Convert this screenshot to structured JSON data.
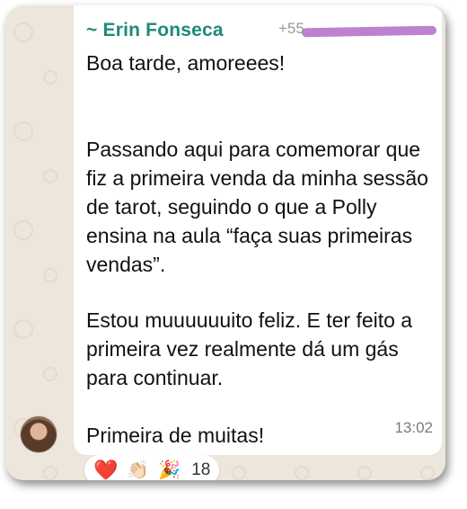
{
  "message": {
    "sender_name": "~ Erin Fonseca",
    "sender_phone": "+55",
    "paragraphs": [
      "Boa tarde, amoreees!",
      "Passando aqui para comemorar que fiz a primeira venda da minha sessão de tarot, seguindo o que a Polly ensina na aula “faça suas primeiras vendas”.",
      "Estou muuuuuuito feliz. E ter feito a primeira vez realmente dá um gás para continuar.",
      "Primeira de muitas!"
    ],
    "time": "13:02"
  },
  "reactions": {
    "emojis": [
      {
        "icon": "heart-icon",
        "glyph": "❤️"
      },
      {
        "icon": "clapping-hands-icon",
        "glyph": "👏🏻"
      },
      {
        "icon": "party-popper-icon",
        "glyph": "🎉"
      }
    ],
    "count": "18"
  },
  "colors": {
    "sender_name": "#1f8a77",
    "redaction": "#b06bc7",
    "bubble": "#ffffff",
    "background": "#ece6dc"
  }
}
